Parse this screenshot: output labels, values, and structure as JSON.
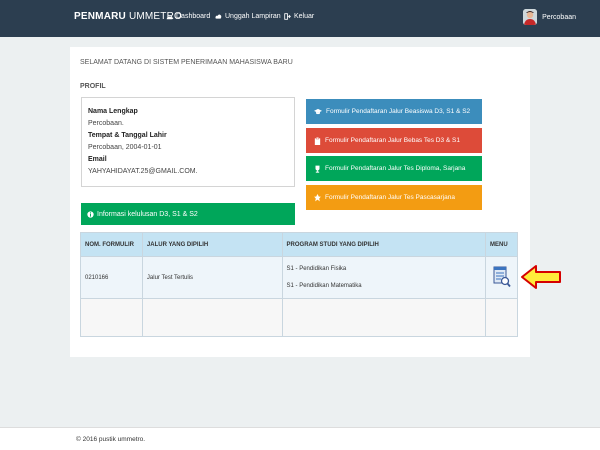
{
  "navbar": {
    "brand_bold": "PENMARU",
    "brand_light": " UMMETRO",
    "links": [
      {
        "label": "Dashboard",
        "icon": "dashboard-icon"
      },
      {
        "label": "Unggah Lampiran",
        "icon": "upload-icon"
      },
      {
        "label": "Keluar",
        "icon": "logout-icon"
      }
    ],
    "user": "Percobaan"
  },
  "main": {
    "welcome": "SELAMAT DATANG DI SISTEM PENERIMAAN MAHASISWA BARU",
    "profile_title": "PROFIL",
    "profile": {
      "name_label": "Nama Lengkap",
      "name_value": "Percobaan.",
      "birth_label": "Tempat & Tanggal Lahir",
      "birth_value": "Percobaan, 2004-01-01",
      "email_label": "Email",
      "email_value": "YAHYAHIDAYAT.25@GMAIL.COM."
    },
    "info_button": "Informasi kelulusan D3, S1 & S2",
    "forms": [
      {
        "label": "Formulir Pendaftaran Jalur Beasiswa D3, S1 & S2",
        "color": "#3c8dbc"
      },
      {
        "label": "Formulir Pendaftaran Jalur Bebas Tes D3 & S1",
        "color": "#dd4b39"
      },
      {
        "label": "Formulir Pendaftaran Jalur Tes Diploma, Sarjana",
        "color": "#00a65a"
      },
      {
        "label": "Formulir Pendaftaran Jalur Tes Pascasarjana",
        "color": "#f39c12"
      }
    ],
    "table": {
      "headers": [
        "NOM. FORMULIR",
        "JALUR YANG DIPILIH",
        "PROGRAM STUDI YANG DIPILIH",
        "MENU"
      ],
      "rows": [
        {
          "nomor": "0210166",
          "jalur": "Jalur Test Tertulis",
          "program_1": "S1 - Pendidikan Fisika",
          "program_2": "S1 - Pendidikan Matematika",
          "menu_icon": "document-search-icon"
        }
      ]
    }
  },
  "footer": "© 2016 pustik ummetro."
}
